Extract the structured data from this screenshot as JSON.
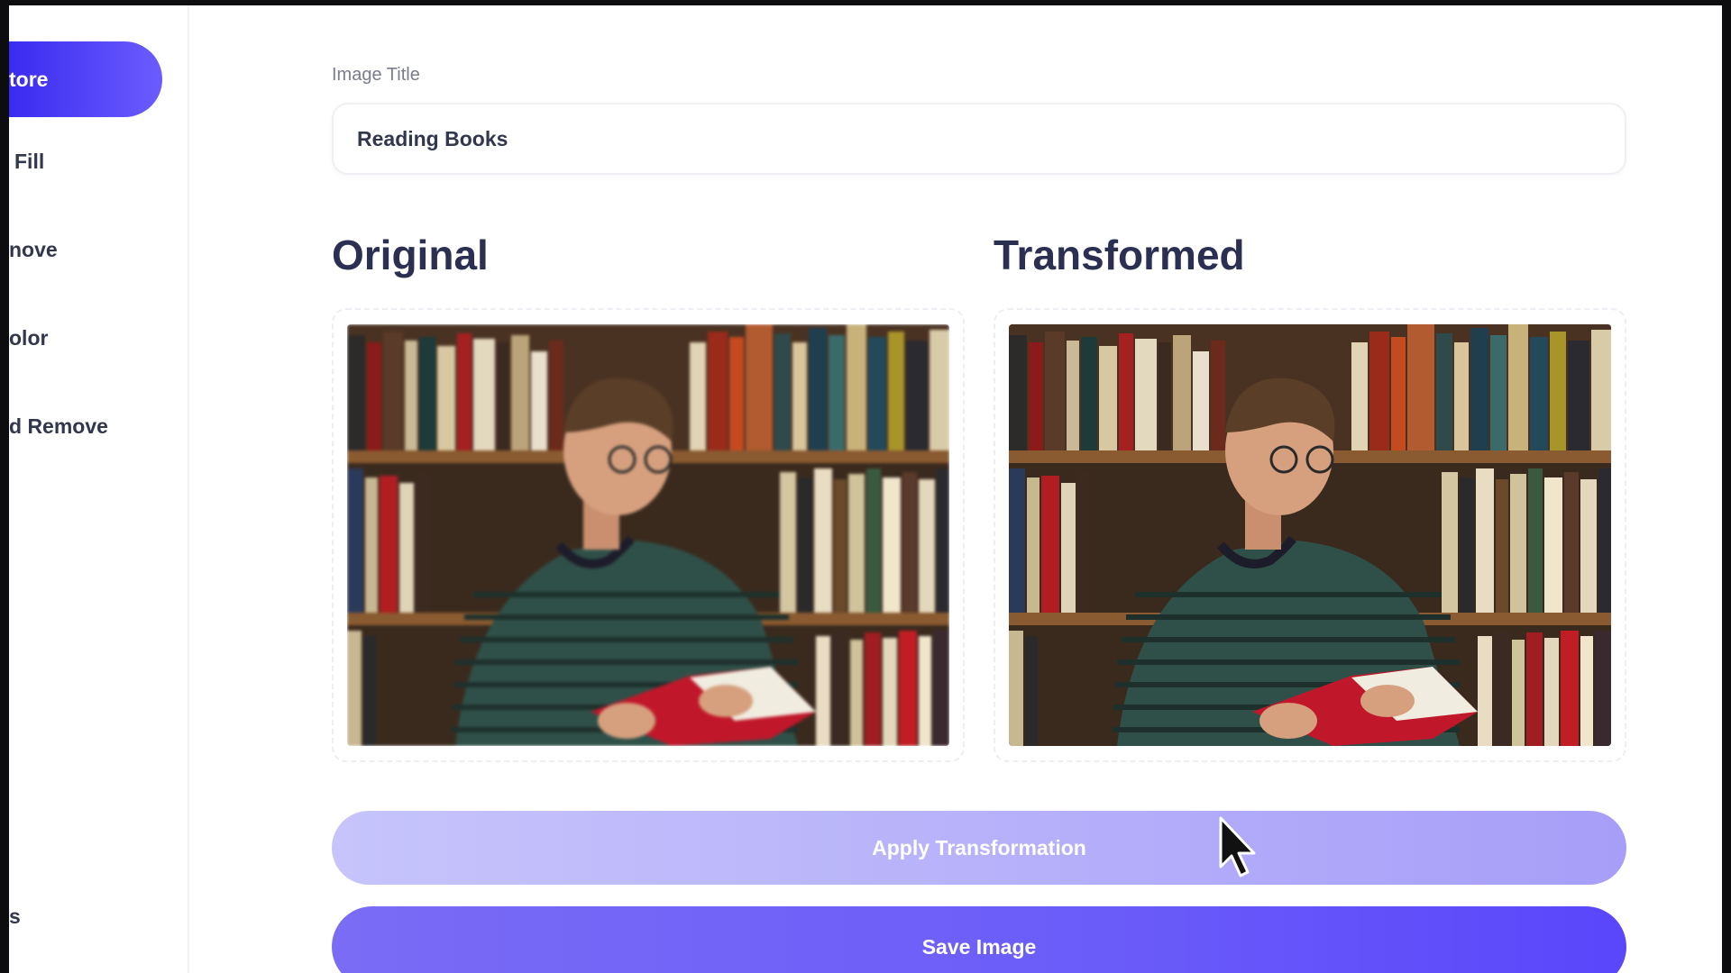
{
  "sidebar": {
    "items": [
      {
        "label": "tore",
        "active": true
      },
      {
        "label": "Fill"
      },
      {
        "label": "nove"
      },
      {
        "label": "olor"
      },
      {
        "label": "d Remove"
      },
      {
        "label": "s"
      }
    ]
  },
  "form": {
    "title_label": "Image Title",
    "title_value": "Reading Books"
  },
  "panels": {
    "original_heading": "Original",
    "transformed_heading": "Transformed"
  },
  "actions": {
    "apply_label": "Apply Transformation",
    "save_label": "Save Image"
  },
  "colors": {
    "accent": "#5a46fb",
    "heading": "#2b2f52",
    "apply_button": "#b4aefa"
  }
}
